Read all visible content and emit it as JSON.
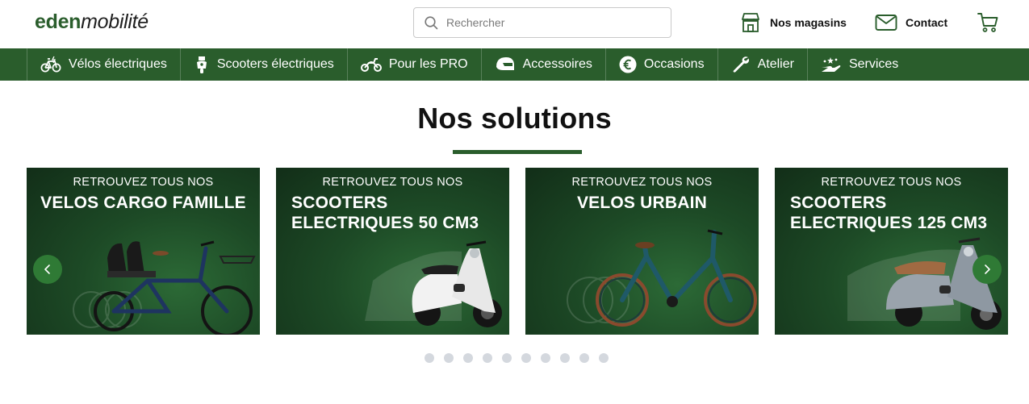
{
  "header": {
    "logo_part1": "eden",
    "logo_part2": "mobilité",
    "search_placeholder": "Rechercher",
    "stores_label": "Nos magasins",
    "contact_label": "Contact"
  },
  "nav": {
    "items": [
      {
        "label": "Vélos électriques",
        "icon": "bike-icon"
      },
      {
        "label": "Scooters électriques",
        "icon": "scooter-icon"
      },
      {
        "label": "Pour les PRO",
        "icon": "motorbike-icon"
      },
      {
        "label": "Accessoires",
        "icon": "helmet-icon"
      },
      {
        "label": "Occasions",
        "icon": "euro-icon"
      },
      {
        "label": "Atelier",
        "icon": "wrench-icon"
      },
      {
        "label": "Services",
        "icon": "hand-stars-icon"
      }
    ]
  },
  "section": {
    "title": "Nos solutions"
  },
  "carousel": {
    "cards": [
      {
        "pre": "RETROUVEZ TOUS NOS",
        "heading": "VELOS CARGO FAMILLE"
      },
      {
        "pre": "RETROUVEZ TOUS NOS",
        "heading": "SCOOTERS ELECTRIQUES 50 CM3"
      },
      {
        "pre": "RETROUVEZ TOUS NOS",
        "heading": "VELOS URBAIN"
      },
      {
        "pre": "RETROUVEZ TOUS NOS",
        "heading": "SCOOTERS ELECTRIQUES 125 CM3"
      }
    ],
    "dot_count": 10,
    "colors": {
      "brand_green": "#2a5d2c",
      "arrow_green": "#2f7a35",
      "dot": "#d4d8de"
    }
  }
}
